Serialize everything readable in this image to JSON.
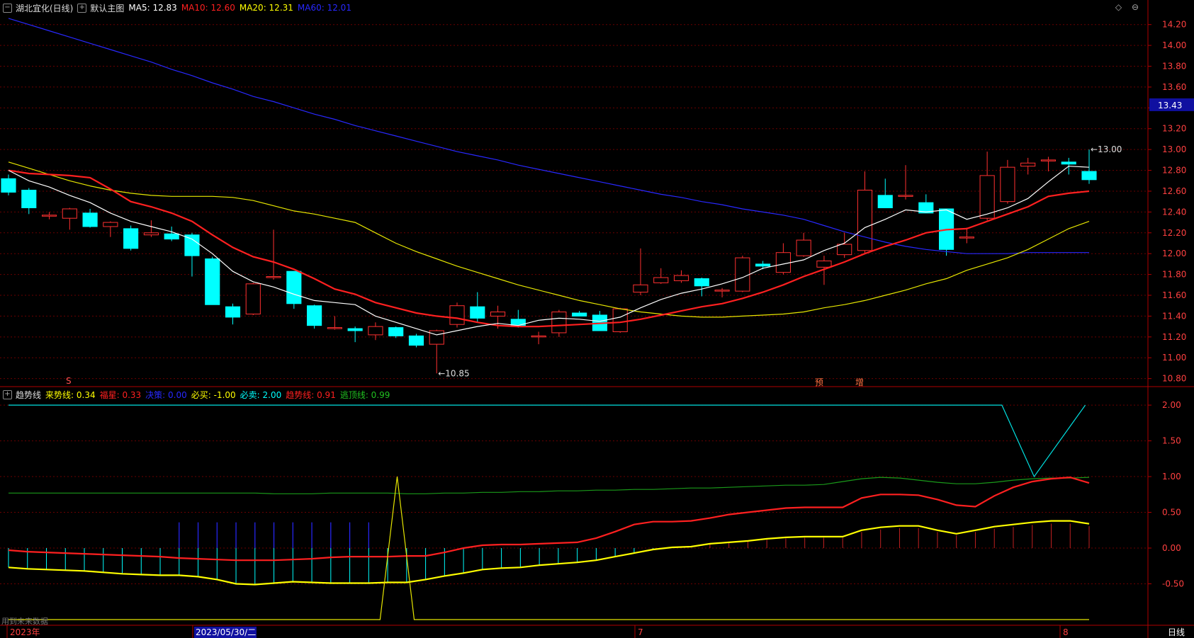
{
  "header": {
    "stock": "湖北宜化(日线)",
    "main_chart": "默认主图",
    "ma": [
      {
        "label": "MA5:",
        "value": "12.83",
        "color": "#ffffff"
      },
      {
        "label": "MA10:",
        "value": "12.60",
        "color": "#ff2020"
      },
      {
        "label": "MA20:",
        "value": "12.31",
        "color": "#ffff00"
      },
      {
        "label": "MA60:",
        "value": "12.01",
        "color": "#2828ff"
      }
    ]
  },
  "indicator": {
    "name": "趋势线",
    "items": [
      {
        "label": "来势线:",
        "value": "0.34",
        "color": "#ffff00"
      },
      {
        "label": "福星:",
        "value": "0.33",
        "color": "#ff2020"
      },
      {
        "label": "决策:",
        "value": "0.00",
        "color": "#2828ff"
      },
      {
        "label": "必买:",
        "value": "-1.00",
        "color": "#ffff00"
      },
      {
        "label": "必卖:",
        "value": "2.00",
        "color": "#00ffff"
      },
      {
        "label": "趋势线:",
        "value": "0.91",
        "color": "#ff2020"
      },
      {
        "label": "逃顶线:",
        "value": "0.99",
        "color": "#20c020"
      }
    ]
  },
  "toolbar": {
    "diamond": "◇",
    "zoom_out": "⊖"
  },
  "price_axis": {
    "ticks": [
      "14.20",
      "14.00",
      "13.80",
      "13.60",
      "13.40",
      "13.20",
      "13.00",
      "12.80",
      "12.60",
      "12.40",
      "12.20",
      "12.00",
      "11.80",
      "11.60",
      "11.40",
      "11.20",
      "11.00",
      "10.80"
    ],
    "current": "13.43"
  },
  "indicator_axis": {
    "ticks": [
      "2.00",
      "1.50",
      "1.00",
      "0.50",
      "0.00",
      "-0.50"
    ]
  },
  "markers": {
    "low": "←10.85",
    "high": "←13.00",
    "left_tag": "S",
    "tag1": "预",
    "tag2": "增"
  },
  "date_axis": {
    "labels": [
      "2023年",
      "2023/05/30/二",
      "7",
      "8"
    ],
    "period": "日线"
  },
  "note": "用到未来数据",
  "colors": {
    "up": "#ff3030",
    "down": "#00ffff",
    "grid": "#6a0000",
    "border": "#b00000"
  },
  "chart_data": {
    "type": "candlestick",
    "candles": [
      [
        12.72,
        12.76,
        12.56,
        12.59
      ],
      [
        12.61,
        12.63,
        12.38,
        12.44
      ],
      [
        12.37,
        12.4,
        12.33,
        12.37
      ],
      [
        12.34,
        12.44,
        12.23,
        12.43
      ],
      [
        12.39,
        12.43,
        12.25,
        12.26
      ],
      [
        12.26,
        12.31,
        12.16,
        12.3
      ],
      [
        12.24,
        12.27,
        12.03,
        12.05
      ],
      [
        12.18,
        12.32,
        12.16,
        12.2
      ],
      [
        12.19,
        12.26,
        12.12,
        12.14
      ],
      [
        12.18,
        12.2,
        11.78,
        11.98
      ],
      [
        11.95,
        11.97,
        11.51,
        11.51
      ],
      [
        11.49,
        11.52,
        11.32,
        11.39
      ],
      [
        11.42,
        11.72,
        11.41,
        11.71
      ],
      [
        11.78,
        12.23,
        11.75,
        11.78
      ],
      [
        11.83,
        11.83,
        11.47,
        11.52
      ],
      [
        11.5,
        11.51,
        11.28,
        11.31
      ],
      [
        11.29,
        11.4,
        11.27,
        11.29
      ],
      [
        11.28,
        11.3,
        11.15,
        11.26
      ],
      [
        11.22,
        11.34,
        11.17,
        11.3
      ],
      [
        11.29,
        11.3,
        11.19,
        11.21
      ],
      [
        11.21,
        11.23,
        11.1,
        11.12
      ],
      [
        11.13,
        11.27,
        10.85,
        11.26
      ],
      [
        11.32,
        11.53,
        11.29,
        11.5
      ],
      [
        11.49,
        11.63,
        11.34,
        11.38
      ],
      [
        11.4,
        11.5,
        11.28,
        11.44
      ],
      [
        11.37,
        11.46,
        11.29,
        11.3
      ],
      [
        11.21,
        11.25,
        11.13,
        11.21
      ],
      [
        11.24,
        11.46,
        11.2,
        11.44
      ],
      [
        11.43,
        11.45,
        11.41,
        11.4
      ],
      [
        11.41,
        11.45,
        11.26,
        11.26
      ],
      [
        11.25,
        11.48,
        11.24,
        11.47
      ],
      [
        11.63,
        12.05,
        11.6,
        11.7
      ],
      [
        11.72,
        11.86,
        11.71,
        11.77
      ],
      [
        11.74,
        11.84,
        11.72,
        11.79
      ],
      [
        11.76,
        11.77,
        11.59,
        11.69
      ],
      [
        11.65,
        11.67,
        11.58,
        11.65
      ],
      [
        11.64,
        11.98,
        11.63,
        11.96
      ],
      [
        11.9,
        11.93,
        11.85,
        11.88
      ],
      [
        11.82,
        12.1,
        11.8,
        12.01
      ],
      [
        11.98,
        12.2,
        11.97,
        12.13
      ],
      [
        11.87,
        11.98,
        11.7,
        11.93
      ],
      [
        11.99,
        12.2,
        11.96,
        12.09
      ],
      [
        12.03,
        12.79,
        12.0,
        12.61
      ],
      [
        12.56,
        12.72,
        12.44,
        12.44
      ],
      [
        12.56,
        12.85,
        12.52,
        12.56
      ],
      [
        12.49,
        12.57,
        12.4,
        12.39
      ],
      [
        12.43,
        12.43,
        11.98,
        12.04
      ],
      [
        12.15,
        12.25,
        12.1,
        12.16
      ],
      [
        12.34,
        12.98,
        12.32,
        12.75
      ],
      [
        12.5,
        12.9,
        12.48,
        12.83
      ],
      [
        12.84,
        12.92,
        12.76,
        12.87
      ],
      [
        12.89,
        12.93,
        12.79,
        12.9
      ],
      [
        12.88,
        12.92,
        12.76,
        12.86
      ],
      [
        12.79,
        13.0,
        12.67,
        12.71
      ]
    ],
    "ma5": [
      12.8,
      12.7,
      12.64,
      12.56,
      12.49,
      12.39,
      12.31,
      12.26,
      12.21,
      12.14,
      12.0,
      11.83,
      11.73,
      11.68,
      11.61,
      11.55,
      11.53,
      11.51,
      11.4,
      11.34,
      11.28,
      11.22,
      11.26,
      11.3,
      11.33,
      11.31,
      11.36,
      11.38,
      11.37,
      11.35,
      11.39,
      11.48,
      11.56,
      11.62,
      11.66,
      11.71,
      11.77,
      11.86,
      11.9,
      11.94,
      12.03,
      12.1,
      12.25,
      12.33,
      12.42,
      12.4,
      12.42,
      12.33,
      12.38,
      12.44,
      12.53,
      12.69,
      12.84,
      12.83
    ],
    "ma10": [
      12.8,
      12.77,
      12.76,
      12.75,
      12.73,
      12.62,
      12.5,
      12.45,
      12.39,
      12.31,
      12.18,
      12.06,
      11.97,
      11.92,
      11.85,
      11.76,
      11.66,
      11.61,
      11.53,
      11.48,
      11.43,
      11.4,
      11.38,
      11.34,
      11.31,
      11.3,
      11.3,
      11.31,
      11.32,
      11.33,
      11.34,
      11.37,
      11.41,
      11.45,
      11.49,
      11.52,
      11.57,
      11.63,
      11.7,
      11.78,
      11.85,
      11.92,
      12.0,
      12.07,
      12.13,
      12.2,
      12.23,
      12.24,
      12.31,
      12.38,
      12.45,
      12.55,
      12.58,
      12.6
    ],
    "ma20": [
      12.88,
      12.82,
      12.76,
      12.7,
      12.65,
      12.61,
      12.58,
      12.56,
      12.55,
      12.55,
      12.55,
      12.54,
      12.51,
      12.46,
      12.41,
      12.38,
      12.34,
      12.3,
      12.2,
      12.1,
      12.02,
      11.95,
      11.88,
      11.82,
      11.76,
      11.7,
      11.65,
      11.6,
      11.55,
      11.51,
      11.47,
      11.44,
      11.42,
      11.4,
      11.39,
      11.39,
      11.4,
      11.41,
      11.42,
      11.44,
      11.48,
      11.51,
      11.55,
      11.6,
      11.65,
      11.71,
      11.76,
      11.84,
      11.9,
      11.96,
      12.04,
      12.14,
      12.24,
      12.31
    ],
    "ma60": [
      14.26,
      14.2,
      14.14,
      14.08,
      14.02,
      13.96,
      13.9,
      13.84,
      13.77,
      13.71,
      13.64,
      13.58,
      13.51,
      13.46,
      13.4,
      13.34,
      13.29,
      13.23,
      13.18,
      13.13,
      13.08,
      13.03,
      12.98,
      12.94,
      12.9,
      12.85,
      12.81,
      12.77,
      12.73,
      12.69,
      12.65,
      12.61,
      12.57,
      12.54,
      12.5,
      12.47,
      12.43,
      12.4,
      12.37,
      12.33,
      12.27,
      12.21,
      12.16,
      12.11,
      12.07,
      12.04,
      12.02,
      12.0,
      12.0,
      12.0,
      12.01,
      12.01,
      12.01,
      12.01
    ],
    "trend": [
      -0.03,
      -0.05,
      -0.06,
      -0.07,
      -0.08,
      -0.09,
      -0.1,
      -0.11,
      -0.12,
      -0.14,
      -0.15,
      -0.16,
      -0.17,
      -0.17,
      -0.17,
      -0.16,
      -0.15,
      -0.13,
      -0.12,
      -0.12,
      -0.12,
      -0.11,
      -0.11,
      -0.06,
      0.0,
      0.04,
      0.05,
      0.05,
      0.06,
      0.07,
      0.08,
      0.14,
      0.23,
      0.33,
      0.37,
      0.37,
      0.38,
      0.42,
      0.47,
      0.5,
      0.53,
      0.56,
      0.57,
      0.57,
      0.57,
      0.7,
      0.75,
      0.75,
      0.74,
      0.68,
      0.6,
      0.58,
      0.73,
      0.85,
      0.93,
      0.97,
      0.99,
      0.91
    ],
    "escape": [
      0.77,
      0.77,
      0.77,
      0.77,
      0.77,
      0.77,
      0.77,
      0.77,
      0.77,
      0.77,
      0.77,
      0.77,
      0.77,
      0.77,
      0.76,
      0.76,
      0.76,
      0.77,
      0.77,
      0.77,
      0.77,
      0.76,
      0.76,
      0.77,
      0.77,
      0.78,
      0.78,
      0.79,
      0.79,
      0.8,
      0.8,
      0.81,
      0.81,
      0.82,
      0.82,
      0.83,
      0.84,
      0.84,
      0.85,
      0.86,
      0.87,
      0.88,
      0.88,
      0.89,
      0.93,
      0.97,
      0.99,
      0.98,
      0.95,
      0.92,
      0.9,
      0.9,
      0.92,
      0.95,
      0.97,
      0.98,
      0.98,
      0.99
    ],
    "laishi": [
      -0.27,
      -0.29,
      -0.3,
      -0.31,
      -0.32,
      -0.34,
      -0.36,
      -0.37,
      -0.38,
      -0.38,
      -0.4,
      -0.44,
      -0.5,
      -0.51,
      -0.49,
      -0.47,
      -0.48,
      -0.49,
      -0.49,
      -0.49,
      -0.48,
      -0.48,
      -0.44,
      -0.39,
      -0.35,
      -0.3,
      -0.28,
      -0.27,
      -0.24,
      -0.22,
      -0.2,
      -0.17,
      -0.12,
      -0.07,
      -0.02,
      0.01,
      0.02,
      0.06,
      0.08,
      0.1,
      0.13,
      0.15,
      0.16,
      0.16,
      0.16,
      0.25,
      0.29,
      0.31,
      0.31,
      0.25,
      0.2,
      0.25,
      0.3,
      0.33,
      0.36,
      0.38,
      0.38,
      0.34
    ],
    "bimai": [
      -1.0,
      -1.0,
      -1.0,
      -1.0,
      -1.0,
      -1.0,
      -1.0,
      -1.0,
      -1.0,
      -1.0,
      -1.0,
      -1.0,
      -1.0,
      -1.0,
      -1.0,
      -1.0,
      -1.0,
      -1.0,
      -1.0,
      -1.0,
      1.0,
      -1.0,
      -1.0,
      -1.0,
      -1.0,
      -1.0,
      -1.0,
      -1.0,
      -1.0,
      -1.0,
      -1.0,
      -1.0,
      -1.0,
      -1.0,
      -1.0,
      -1.0,
      -1.0,
      -1.0,
      -1.0,
      -1.0,
      -1.0,
      -1.0,
      -1.0,
      -1.0,
      -1.0,
      -1.0,
      -1.0,
      -1.0,
      -1.0,
      -1.0,
      -1.0,
      -1.0,
      -1.0,
      -1.0,
      -1.0,
      -1.0,
      -1.0,
      -1.0
    ],
    "bimai_x": [
      0,
      20,
      21,
      22
    ],
    "bimai_v": [
      -1,
      -1,
      1,
      -1
    ],
    "bimai2": [
      2.0,
      2.0,
      1.0,
      2.0
    ],
    "bimai2_x": [
      0,
      51,
      52,
      53
    ],
    "blue_bars": [
      9,
      10,
      11,
      12,
      13,
      14,
      15,
      16,
      17,
      18,
      19
    ],
    "price_ylim": [
      10.75,
      14.3
    ],
    "indicator_ylim": [
      -1.05,
      2.12
    ]
  }
}
